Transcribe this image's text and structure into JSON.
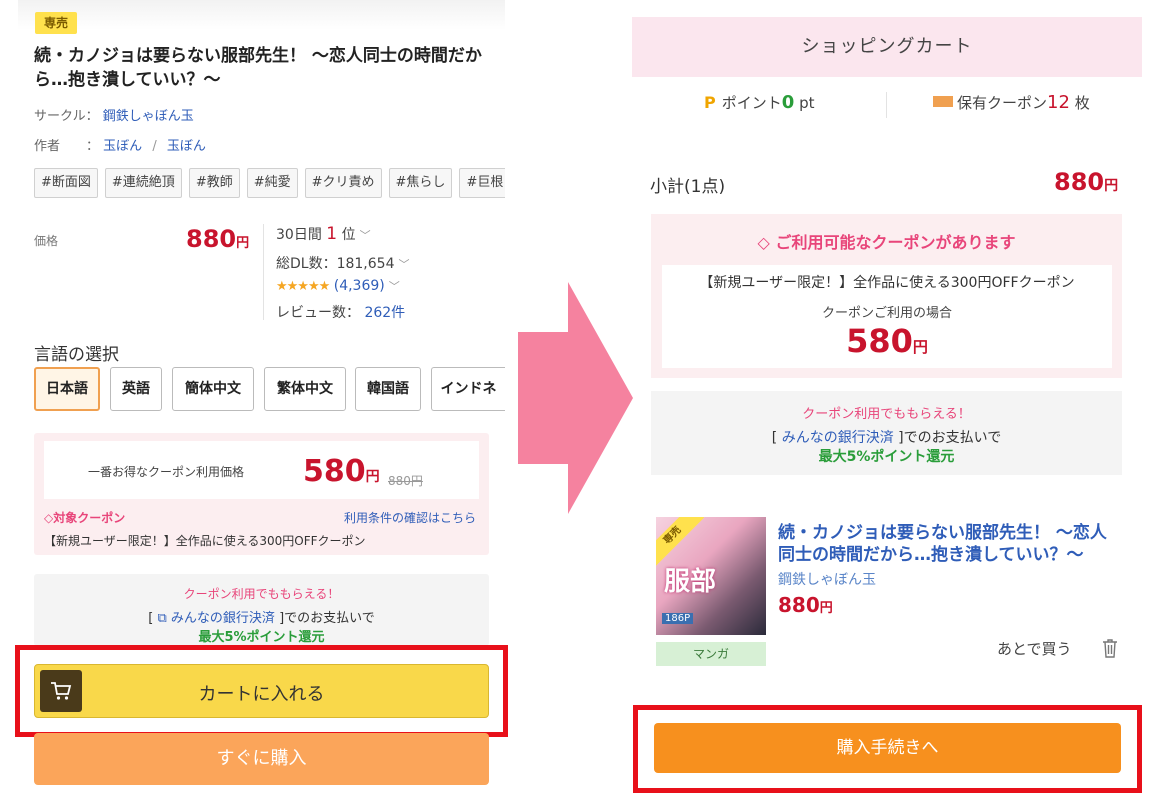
{
  "left": {
    "badge": "専売",
    "title": "続・カノジョは要らない服部先生！ 〜恋人同士の時間だから…抱き潰していい？〜",
    "circle_label": "サークル：",
    "circle_name": "鋼鉄しゃぼん玉",
    "author_label": "作者　　：",
    "author_1": "玉ぼん",
    "author_sep": "/",
    "author_2": "玉ぼん",
    "tags": [
      "#断面図",
      "#連続絶頂",
      "#教師",
      "#純愛",
      "#クリ責め",
      "#焦らし",
      "#巨根"
    ],
    "price_label": "価格",
    "price": "880",
    "yen": "円",
    "rank_prefix": "30日間",
    "rank_num": "1",
    "rank_suffix": "位",
    "downloads": "総DL数：181,654",
    "stars": "★★★★★",
    "rating_count": "(4,369)",
    "reviews_label": "レビュー数：",
    "reviews_count": "262件",
    "lang_heading": "言語の選択",
    "languages": [
      "日本語",
      "英語",
      "簡体中文",
      "繁体中文",
      "韓国語",
      "インドネ"
    ],
    "best_coupon_label": "一番お得なクーポン利用価格",
    "coupon_price": "580",
    "original_price": "880円",
    "target_coupon": "対象クーポン",
    "terms_link": "利用条件の確認はこちら",
    "coupon_desc": "【新規ユーザー限定！】全作品に使える300円OFFクーポン",
    "bank_promo": "クーポン利用でももらえる！",
    "bank_line_pre": "[",
    "bank_name": "みんなの銀行決済",
    "bank_line_post": "]でのお支払いで",
    "bank_reward": "最大5%ポイント還元",
    "add_to_cart": "カートに入れる",
    "buy_now": "すぐに購入"
  },
  "right": {
    "header": "ショッピングカート",
    "points_label": "ポイント",
    "points_value": "0",
    "points_unit": "pt",
    "coupons_label": "保有クーポン",
    "coupons_value": "12",
    "coupons_unit": "枚",
    "subtotal_label": "小計(1点)",
    "subtotal_price": "880",
    "yen": "円",
    "coupon_available": "ご利用可能なクーポンがあります",
    "coupon_desc": "【新規ユーザー限定！】全作品に使える300円OFFクーポン",
    "coupon_use_label": "クーポンご利用の場合",
    "coupon_price": "580",
    "bank_promo": "クーポン利用でももらえる！",
    "bank_line_pre": "[",
    "bank_name": "みんなの銀行決済",
    "bank_line_post": "]でのお支払いで",
    "bank_reward": "最大5%ポイント還元",
    "item_title": "続・カノジョは要らない服部先生！ 〜恋人同士の時間だから…抱き潰していい？〜",
    "item_circle": "鋼鉄しゃぼん玉",
    "item_price": "880",
    "item_badge": "専売",
    "thumb_text": "服部",
    "thumb_pages": "186P",
    "genre_tag": "マンガ",
    "buy_later": "あとで買う",
    "checkout": "購入手続きへ"
  },
  "colors": {
    "price_red": "#c8142d",
    "highlight_frame": "#e8101a",
    "arrow_pink": "#f5829f",
    "cart_yellow": "#f9d84a",
    "checkout_orange": "#f7901e"
  },
  "icons": [
    "cart-icon",
    "tag-icon",
    "external-link-icon",
    "trash-icon",
    "ticket-icon",
    "point-icon",
    "chevron-down-icon"
  ]
}
